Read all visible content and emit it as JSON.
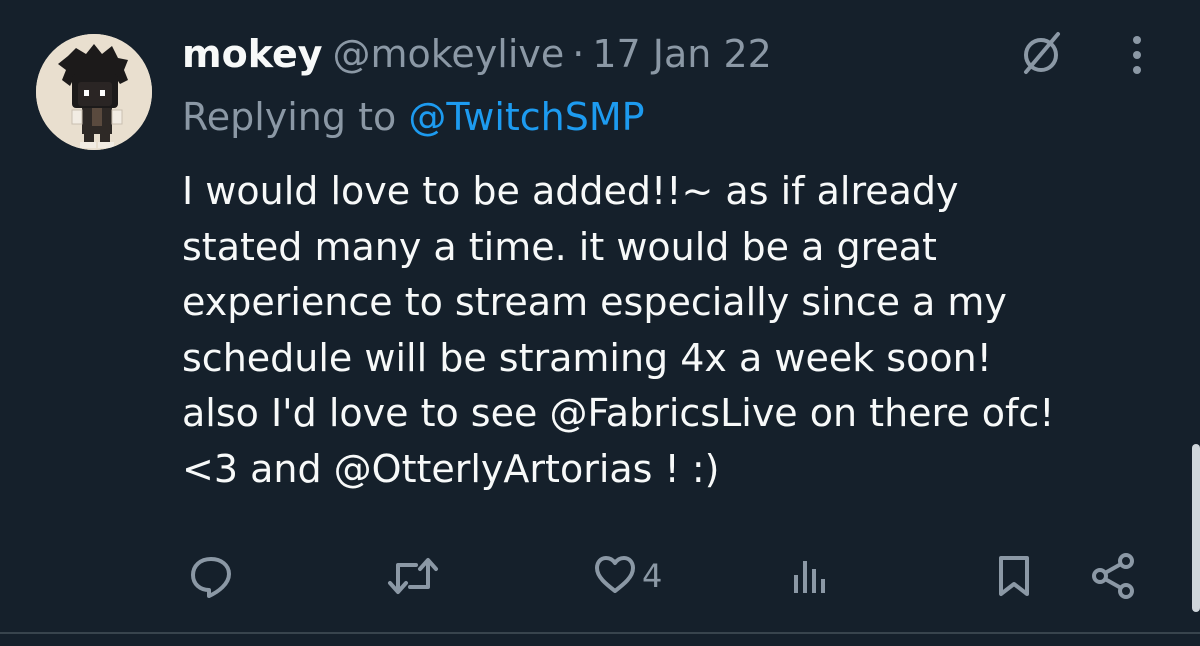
{
  "tweet": {
    "display_name": "mokey",
    "handle": "@mokeylive",
    "separator": "·",
    "timestamp": "17 Jan 22",
    "reply_prefix": "Replying to",
    "reply_target": "@TwitchSMP",
    "text_lines": [
      "I would love to be added!!~ as if already",
      "stated many a time. it would be a great",
      "experience to stream especially since a my",
      "schedule will be straming 4x a week soon!",
      "also I'd love to see @FabricsLive on there ofc!",
      "<3 and @OtterlyArtorias ! :)"
    ]
  },
  "actions": {
    "like_count": "4"
  },
  "icons": {
    "avatar": "pixel-character-avatar",
    "grok": "grok-slash-circle-icon",
    "more": "more-vertical-icon",
    "reply": "reply-bubble-icon",
    "retweet": "retweet-icon",
    "like": "heart-icon",
    "views": "views-bar-chart-icon",
    "bookmark": "bookmark-icon",
    "share": "share-icon"
  },
  "colors": {
    "background": "#15202b",
    "text_primary": "#f7f9f9",
    "text_secondary": "#8b98a5",
    "accent": "#1d9bf0"
  }
}
